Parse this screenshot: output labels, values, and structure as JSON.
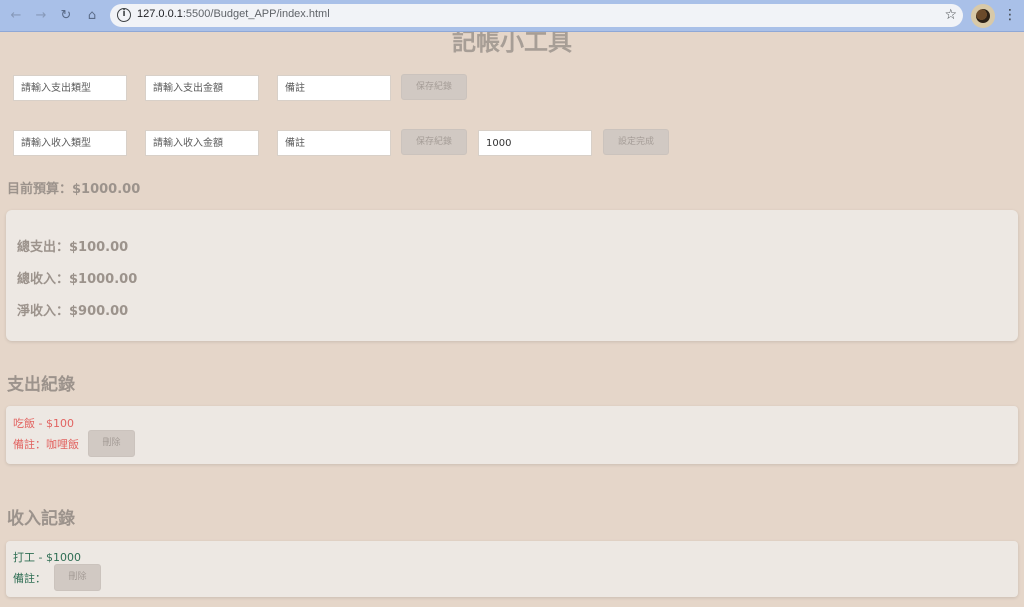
{
  "browser": {
    "url_host": "127.0.0.1",
    "url_path": ":5500/Budget_APP/index.html"
  },
  "page": {
    "title": "記帳小工具"
  },
  "expense_form": {
    "type_placeholder": "請輸入支出類型",
    "amount_placeholder": "請輸入支出金額",
    "note_placeholder": "備註",
    "save_label": "保存紀錄"
  },
  "income_form": {
    "type_placeholder": "請輸入收入類型",
    "amount_placeholder": "請輸入收入金額",
    "note_placeholder": "備註",
    "save_label": "保存紀錄",
    "budget_value": "1000",
    "budget_set_label": "設定完成"
  },
  "budget": {
    "text": "目前預算：$1000.00"
  },
  "summary": {
    "total_expense": "總支出：$100.00",
    "total_income": "總收入：$1000.00",
    "net_income": "淨收入：$900.00"
  },
  "expense_records": {
    "heading": "支出紀錄",
    "items": [
      {
        "title": "吃飯 - $100",
        "note": "備註：咖哩飯",
        "delete_label": "刪除"
      }
    ]
  },
  "income_records": {
    "heading": "收入記錄",
    "items": [
      {
        "title": "打工 - $1000",
        "note": "備註：",
        "delete_label": "刪除"
      }
    ]
  },
  "colors": {
    "page_background": "#e5d6c9",
    "card_background": "#ede8e3",
    "expense_text": "#e26461",
    "income_text": "#2f6e54",
    "button_background": "#d1c9c3"
  }
}
